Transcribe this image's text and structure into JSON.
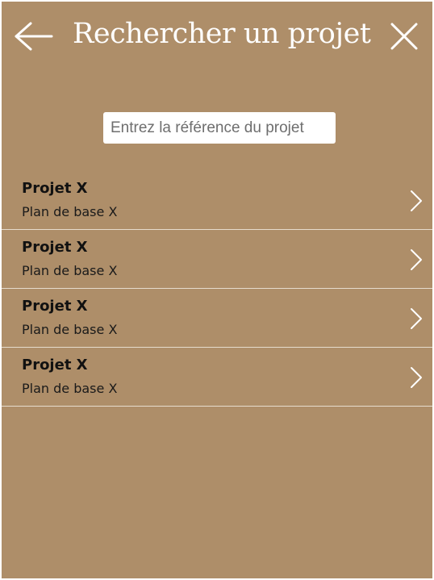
{
  "header": {
    "title": "Rechercher un projet",
    "back_icon": "arrow-left-icon",
    "close_icon": "close-icon"
  },
  "search": {
    "placeholder": "Entrez la référence du projet",
    "value": ""
  },
  "projects": [
    {
      "title": "Projet X",
      "subtitle": "Plan de base X"
    },
    {
      "title": "Projet X",
      "subtitle": "Plan de base X"
    },
    {
      "title": "Projet X",
      "subtitle": "Plan de base X"
    },
    {
      "title": "Projet X",
      "subtitle": "Plan de base X"
    }
  ],
  "colors": {
    "background": "#ae8e69",
    "foreground": "#ffffff",
    "divider": "#e6dccd"
  }
}
